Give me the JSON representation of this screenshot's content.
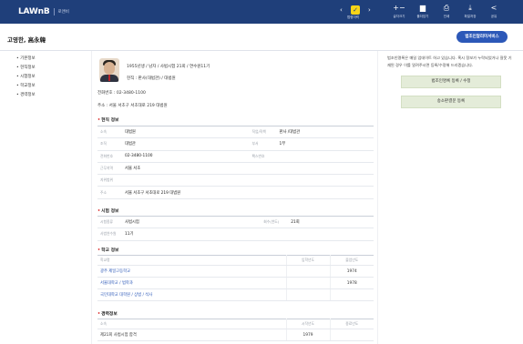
{
  "topbar": {
    "logo": "LAWnB",
    "logo_sub": "로앤비",
    "nav_label": "법령이력",
    "tools": [
      {
        "icon": "plus-minus-icon",
        "label": "글자크기"
      },
      {
        "icon": "folder-icon",
        "label": "폴더담기"
      },
      {
        "icon": "print-icon",
        "label": "인쇄"
      },
      {
        "icon": "download-icon",
        "label": "파일저장"
      },
      {
        "icon": "share-icon",
        "label": "공유"
      }
    ]
  },
  "header": {
    "name": "고영한, 高永韓",
    "notify_button": "법조인알리미서비스"
  },
  "leftnav": [
    "• 기본정보",
    "• 현직정보",
    "• 시험정보",
    "• 학교정보",
    "• 경력정보"
  ],
  "profile": {
    "line1": "1955년생 / 남자 / 사법시험 21회 / 연수원11기",
    "line2": "현직 : 판사(대법관) / 대법원",
    "phone": "전화번호 : 02-3480-1100",
    "address": "주소 : 서울 서초구 서초대로 219 대법원"
  },
  "current": {
    "title": "현직 정보",
    "rows": [
      {
        "k": "소속",
        "v": "대법원",
        "k2": "직업/직책",
        "v2": "판사 /대법관"
      },
      {
        "k": "조직",
        "v": "대법관",
        "k2": "부서",
        "v2": "1부"
      },
      {
        "k": "전화번호",
        "v": "02-3480-1100",
        "k2": "팩스번호",
        "v2": ""
      },
      {
        "k": "근무지역",
        "v": "서울 서초",
        "k2": "",
        "v2": ""
      },
      {
        "k": "지위범위",
        "v": "",
        "k2": "",
        "v2": ""
      },
      {
        "k": "주소",
        "v": "서울 서초구 서초대로 219 대법원",
        "k2": "",
        "v2": ""
      }
    ]
  },
  "exam": {
    "title": "시험 정보",
    "rows": [
      {
        "k": "시험종류",
        "v": "사법시험",
        "k2": "회수(연도)",
        "v2": "21회"
      },
      {
        "k": "사법연수원",
        "v": "11기",
        "k2": "",
        "v2": ""
      }
    ]
  },
  "school": {
    "title": "학교 정보",
    "headers": [
      "학교명",
      "입학년도",
      "졸업년도"
    ],
    "rows": [
      {
        "name": "광주 제일고등학교",
        "in": "",
        "out": "1974"
      },
      {
        "name": "서울대학교 / 법학과",
        "in": "",
        "out": "1978"
      },
      {
        "name": "국민대학교 대학원 / 상법 / 석사",
        "in": "",
        "out": ""
      }
    ]
  },
  "career": {
    "title": "경력정보",
    "headers": [
      "소속",
      "시작년도",
      "종료년도"
    ],
    "rows": [
      {
        "name": "제21회 사법시험 합격",
        "in": "1979",
        "out": ""
      }
    ]
  },
  "right": {
    "message": "법조인명록은 매일 업데이트 하고 있습니다. 혹시 정보가 누락되었거나 잘못 기재된 경우 이를 알려주시면 등록/수정해 드리겠습니다.",
    "btn1": "법조인명록 등록 / 수정",
    "btn2": "송소판결문 등록"
  }
}
